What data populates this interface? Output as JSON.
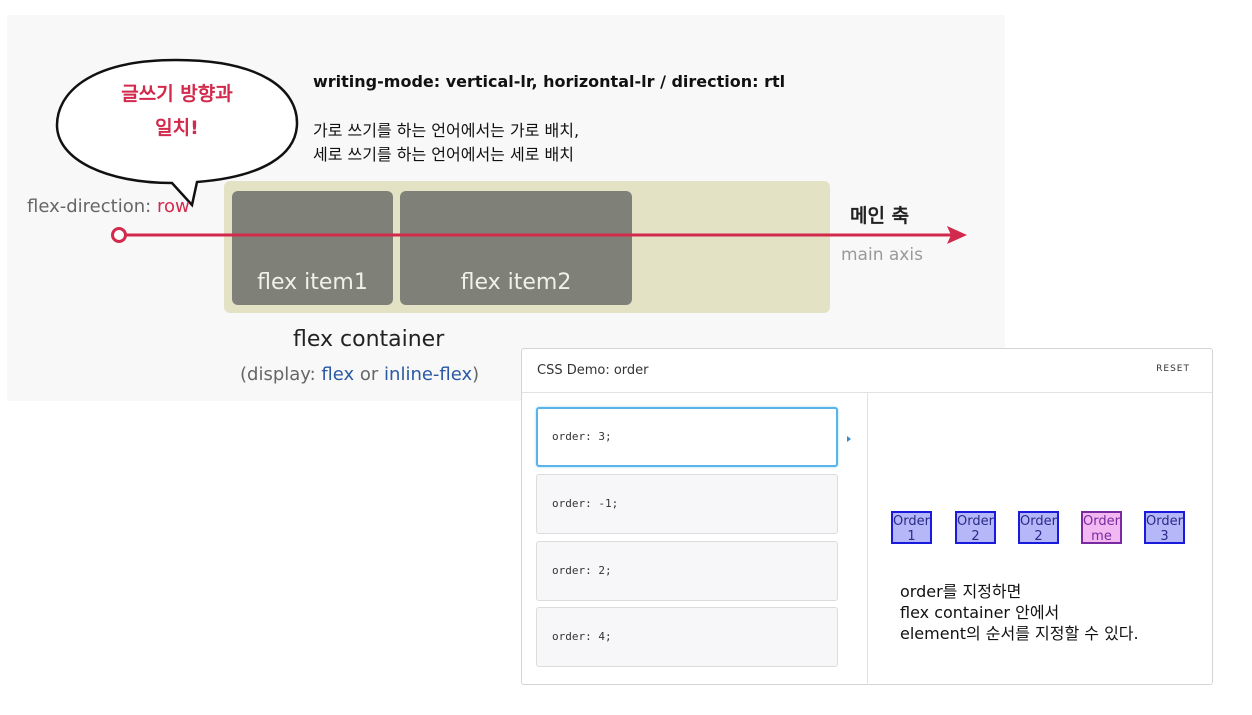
{
  "diagram": {
    "bubble": {
      "line1": "글쓰기 방향과",
      "line2": "일치!"
    },
    "writing_mode_title": "writing-mode: vertical-lr, horizontal-lr / direction: rtl",
    "writing_mode_desc": {
      "line1": "가로 쓰기를 하는 언어에서는 가로 배치,",
      "line2": "세로 쓰기를 하는 언어에서는 세로 배치"
    },
    "flex_direction_label": "flex-direction:",
    "flex_direction_value": "row",
    "items": [
      "flex item1",
      "flex item2"
    ],
    "main_axis_ko": "메인 축",
    "main_axis_en": "main axis",
    "container_label": "flex container",
    "container_sub": {
      "open": "(display: ",
      "flex": "flex",
      "or": " or ",
      "inline_flex": "inline-flex",
      "close": ")"
    },
    "colors": {
      "accent": "#d22a4c",
      "container": "#e3e2c4",
      "item": "#7f8178",
      "keyword": "#2a58a3"
    }
  },
  "demo": {
    "title": "CSS Demo: order",
    "reset": "RESET",
    "options": [
      "order: 3;",
      "order: -1;",
      "order: 2;",
      "order: 4;"
    ],
    "selected_index": 0,
    "boxes": [
      {
        "label": "Order",
        "value": "1"
      },
      {
        "label": "Order",
        "value": "2"
      },
      {
        "label": "Order",
        "value": "2"
      },
      {
        "label": "Order",
        "value": "me"
      },
      {
        "label": "Order",
        "value": "3"
      }
    ],
    "note": {
      "line1": "order를 지정하면",
      "line2": "flex container 안에서",
      "line3": "element의 순서를 지정할 수 있다."
    }
  }
}
